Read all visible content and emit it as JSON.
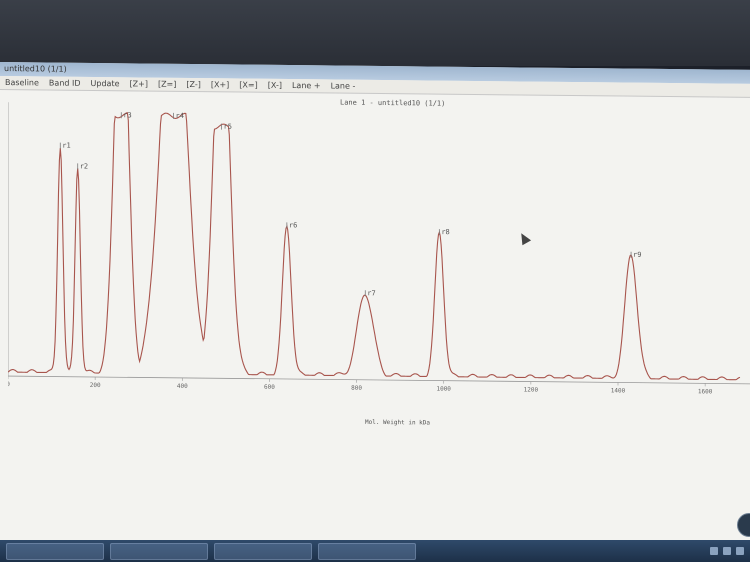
{
  "window": {
    "title": "untitled10 (1/1)"
  },
  "menu": [
    "Baseline",
    "Band ID",
    "Update",
    "[Z+]",
    "[Z=]",
    "[Z-]",
    "[X+]",
    "[X=]",
    "[X-]",
    "Lane +",
    "Lane -"
  ],
  "plot": {
    "title": "Lane 1 - untitled10 (1/1)",
    "x_label": "Mol. Weight in kDa"
  },
  "colors": {
    "trace": "#a8554d",
    "marker": "#7a7a7a"
  },
  "chart_data": {
    "type": "line",
    "x_ticks": [
      0,
      200,
      400,
      600,
      800,
      1000,
      1200,
      1400,
      1600
    ],
    "xlim": [
      0,
      1680
    ],
    "peaks": [
      {
        "label": "r1",
        "x": 120,
        "height": 0.88
      },
      {
        "label": "r2",
        "x": 160,
        "height": 0.8
      },
      {
        "label": "r3",
        "x": 260,
        "height": 1.0
      },
      {
        "label": "r4",
        "x": 380,
        "height": 1.0
      },
      {
        "label": "r5",
        "x": 490,
        "height": 0.96
      },
      {
        "label": "r6",
        "x": 640,
        "height": 0.58
      },
      {
        "label": "r7",
        "x": 820,
        "height": 0.32
      },
      {
        "label": "r8",
        "x": 990,
        "height": 0.56
      },
      {
        "label": "r9",
        "x": 1430,
        "height": 0.48
      }
    ]
  },
  "taskbar": {
    "items": [
      "",
      "",
      "",
      ""
    ]
  }
}
